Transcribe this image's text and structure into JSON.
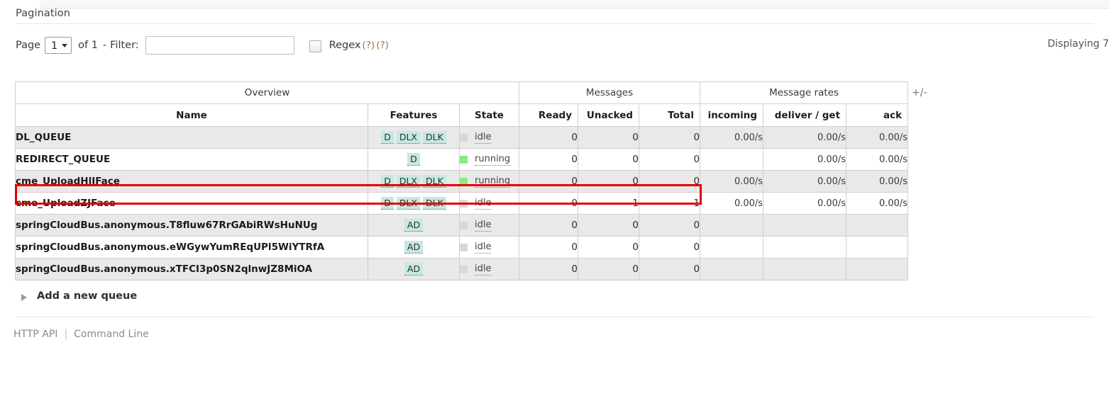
{
  "section": {
    "title": "Pagination"
  },
  "pagination": {
    "page_label": "Page",
    "page_value": "1",
    "of_label": "of 1",
    "dash": "-",
    "filter_label": "Filter:",
    "filter_value": "",
    "filter_placeholder": "",
    "regex_label": "Regex",
    "help_1": "(?)",
    "help_2": "(?)",
    "displaying": "Displaying 7"
  },
  "table": {
    "group_headers": [
      {
        "label": "Overview",
        "colspan": 3
      },
      {
        "label": "Messages",
        "colspan": 3
      },
      {
        "label": "Message rates",
        "colspan": 3
      }
    ],
    "columns": [
      {
        "label": "Name",
        "align": "center"
      },
      {
        "label": "Features",
        "align": "center"
      },
      {
        "label": "State",
        "align": "center"
      },
      {
        "label": "Ready",
        "align": "right"
      },
      {
        "label": "Unacked",
        "align": "right"
      },
      {
        "label": "Total",
        "align": "right"
      },
      {
        "label": "incoming",
        "align": "right"
      },
      {
        "label": "deliver / get",
        "align": "right"
      },
      {
        "label": "ack",
        "align": "right"
      }
    ],
    "expander": "+/-",
    "rows": [
      {
        "name": "DL_QUEUE",
        "features": [
          "D",
          "DLX",
          "DLK"
        ],
        "state": "idle",
        "state_kind": "idle",
        "ready": "0",
        "unacked": "0",
        "total": "0",
        "incoming": "0.00/s",
        "deliver_get": "0.00/s",
        "ack": "0.00/s"
      },
      {
        "name": "REDIRECT_QUEUE",
        "features": [
          "D"
        ],
        "state": "running",
        "state_kind": "running",
        "ready": "0",
        "unacked": "0",
        "total": "0",
        "incoming": "",
        "deliver_get": "0.00/s",
        "ack": "0.00/s"
      },
      {
        "name": "cme_UploadHlJFace",
        "features": [
          "D",
          "DLX",
          "DLK"
        ],
        "state": "running",
        "state_kind": "running",
        "ready": "0",
        "unacked": "0",
        "total": "0",
        "incoming": "0.00/s",
        "deliver_get": "0.00/s",
        "ack": "0.00/s"
      },
      {
        "name": "cme_UploadZJFace",
        "features": [
          "D",
          "DLX",
          "DLK"
        ],
        "state": "idle",
        "state_kind": "idle",
        "ready": "0",
        "unacked": "1",
        "total": "1",
        "incoming": "0.00/s",
        "deliver_get": "0.00/s",
        "ack": "0.00/s"
      },
      {
        "name": "springCloudBus.anonymous.T8fluw67RrGAbiRWsHuNUg",
        "features": [
          "AD"
        ],
        "state": "idle",
        "state_kind": "idle",
        "ready": "0",
        "unacked": "0",
        "total": "0",
        "incoming": "",
        "deliver_get": "",
        "ack": ""
      },
      {
        "name": "springCloudBus.anonymous.eWGywYumREqUPl5WiYTRfA",
        "features": [
          "AD"
        ],
        "state": "idle",
        "state_kind": "idle",
        "ready": "0",
        "unacked": "0",
        "total": "0",
        "incoming": "",
        "deliver_get": "",
        "ack": ""
      },
      {
        "name": "springCloudBus.anonymous.xTFCI3p0SN2qlnwJZ8MiOA",
        "features": [
          "AD"
        ],
        "state": "idle",
        "state_kind": "idle",
        "ready": "0",
        "unacked": "0",
        "total": "0",
        "incoming": "",
        "deliver_get": "",
        "ack": ""
      }
    ]
  },
  "add_queue": {
    "label": "Add a new queue"
  },
  "footer": {
    "http_api": "HTTP API",
    "command_line": "Command Line"
  },
  "colors": {
    "running": "#87eb87",
    "idle": "#d8d8d8",
    "badge_bg": "#c5e8e3",
    "highlight": "#e00000",
    "help_link": "#b06f2a"
  }
}
